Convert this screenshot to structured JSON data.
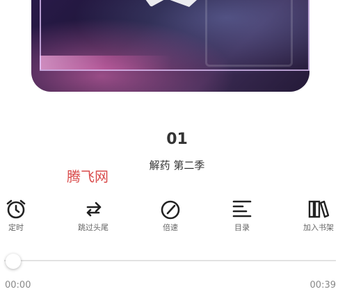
{
  "track": {
    "number": "01",
    "title": "解药 第二季"
  },
  "watermark": "腾飞网",
  "toolbar": {
    "timer": "定时",
    "skip": "跳过头尾",
    "speed": "倍速",
    "catalog": "目录",
    "bookshelf": "加入书架"
  },
  "playback": {
    "current_time": "00:00",
    "total_time": "00:39",
    "progress": 0
  },
  "colors": {
    "text": "#333333",
    "watermark": "#d94b4b",
    "track_bg": "#e2e2e2"
  }
}
